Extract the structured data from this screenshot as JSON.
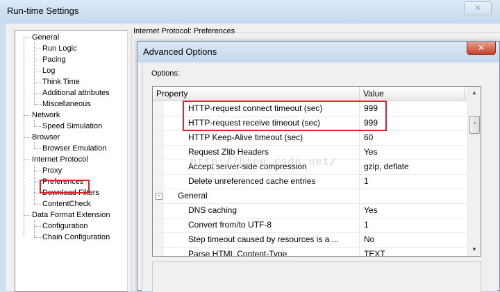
{
  "window": {
    "title": "Run-time Settings"
  },
  "tree": {
    "nodes": [
      {
        "label": "General"
      },
      {
        "label": "Run Logic"
      },
      {
        "label": "Pacing"
      },
      {
        "label": "Log"
      },
      {
        "label": "Think Time"
      },
      {
        "label": "Additional attributes"
      },
      {
        "label": "Miscellaneous"
      },
      {
        "label": "Network"
      },
      {
        "label": "Speed Simulation"
      },
      {
        "label": "Browser"
      },
      {
        "label": "Browser Emulation"
      },
      {
        "label": "Internet Protocol"
      },
      {
        "label": "Proxy"
      },
      {
        "label": "Preferences"
      },
      {
        "label": "Download Filters"
      },
      {
        "label": "ContentCheck"
      },
      {
        "label": "Data Format Extension"
      },
      {
        "label": "Configuration"
      },
      {
        "label": "Chain Configuration"
      }
    ]
  },
  "panel": {
    "section_title": "Internet Protocol: Preferences"
  },
  "dialog": {
    "title": "Advanced Options",
    "options_label": "Options:",
    "columns": {
      "property": "Property",
      "value": "Value"
    },
    "rows": [
      {
        "property": "HTTP-request connect timeout (sec)",
        "value": "999"
      },
      {
        "property": "HTTP-request receive timeout (sec)",
        "value": "999"
      },
      {
        "property": "HTTP Keep-Alive timeout (sec)",
        "value": "60"
      },
      {
        "property": "Request Zlib Headers",
        "value": "Yes"
      },
      {
        "property": "Accept server-side compression",
        "value": "gzip, deflate"
      },
      {
        "property": "Delete unreferenced cache entries",
        "value": "1"
      },
      {
        "property": "General",
        "value": "",
        "category": true
      },
      {
        "property": "DNS caching",
        "value": "Yes"
      },
      {
        "property": "Convert from/to UTF-8",
        "value": "1"
      },
      {
        "property": "Step timeout caused by resources is a ...",
        "value": "No"
      },
      {
        "property": "Parse HTML Content-Type",
        "value": "TEXT"
      }
    ],
    "watermark": "http://blog.csdn.net/"
  },
  "colors": {
    "highlight": "#e0202a",
    "titlebar": "#c5d8ee"
  }
}
